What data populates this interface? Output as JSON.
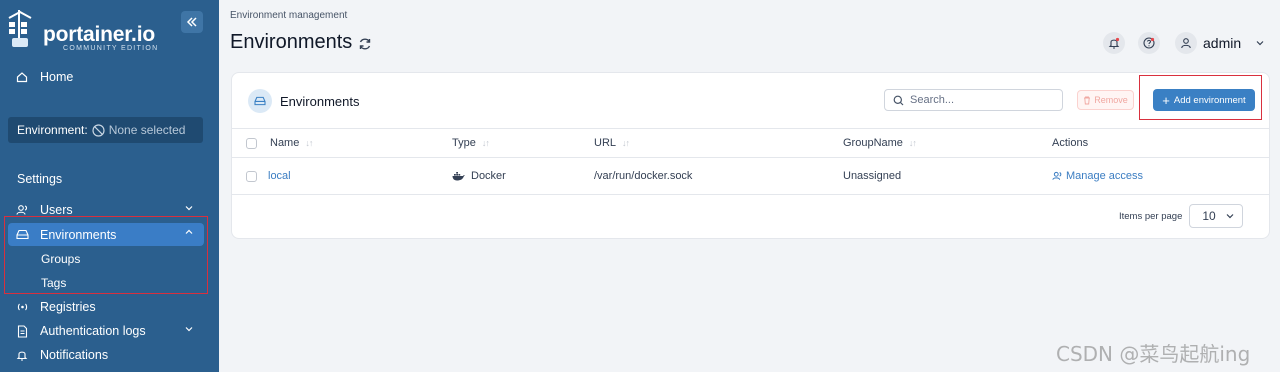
{
  "sidebar": {
    "logo_text": "portainer.io",
    "logo_sub": "COMMUNITY EDITION",
    "home": "Home",
    "env_label": "Environment:",
    "env_value": "None selected",
    "settings": "Settings",
    "users": "Users",
    "environments": "Environments",
    "groups": "Groups",
    "tags": "Tags",
    "registries": "Registries",
    "auth_logs": "Authentication logs",
    "notifications": "Notifications"
  },
  "header": {
    "breadcrumb": "Environment management",
    "title": "Environments",
    "user": "admin"
  },
  "card": {
    "title": "Environments",
    "search_placeholder": "Search...",
    "remove_label": "Remove",
    "add_label": "Add environment",
    "columns": [
      "Name",
      "Type",
      "URL",
      "GroupName",
      "Actions"
    ],
    "rows": [
      {
        "name": "local",
        "type": "Docker",
        "url": "/var/run/docker.sock",
        "group": "Unassigned",
        "action": "Manage access"
      }
    ],
    "items_per_page_label": "Items per page",
    "items_per_page": "10"
  },
  "watermark": "CSDN @菜鸟起航ing",
  "colors": {
    "sidebar": "#2b5f8e",
    "accent": "#3a80c4",
    "highlight": "#d9303e"
  }
}
